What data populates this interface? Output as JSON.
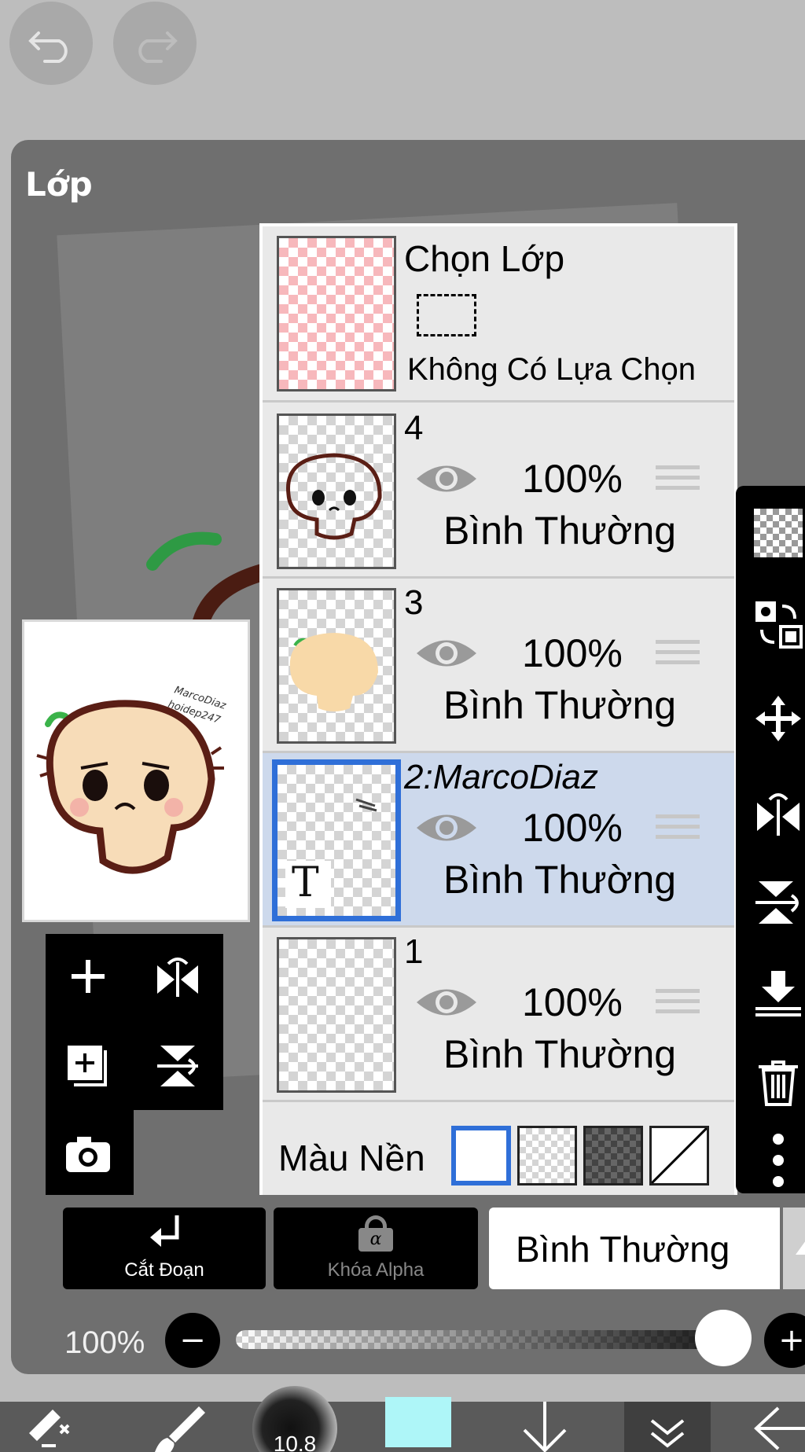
{
  "panel": {
    "title": "Lớp"
  },
  "preview": {
    "watermark_line1": "MarcoDiaz",
    "watermark_line2": "hoidep247"
  },
  "selection_row": {
    "title": "Chọn Lớp",
    "status": "Không Có Lựa Chọn"
  },
  "layers": [
    {
      "name": "4",
      "opacity": "100%",
      "blend": "Bình Thường",
      "selected": false
    },
    {
      "name": "3",
      "opacity": "100%",
      "blend": "Bình Thường",
      "selected": false
    },
    {
      "name": "2:MarcoDiaz",
      "opacity": "100%",
      "blend": "Bình Thường",
      "selected": true,
      "text_layer_mark": "T"
    },
    {
      "name": "1",
      "opacity": "100%",
      "blend": "Bình Thường",
      "selected": false
    }
  ],
  "background": {
    "label": "Màu Nền",
    "selected_swatch": "white"
  },
  "actions": {
    "clip_label": "Cắt Đoạn",
    "alpha_lock_label": "Khóa Alpha",
    "alpha_symbol": "α",
    "blend_mode": "Bình Thường"
  },
  "opacity_control": {
    "label": "100%",
    "minus": "−",
    "plus": "+",
    "value_fraction": 1.0
  },
  "brush": {
    "size_label": "10.8"
  },
  "colors": {
    "selected_blue": "#2f6fd8",
    "selected_row": "#cdd9ec",
    "panel_bg": "#6f6f6f",
    "current_color": "#aef6f8"
  }
}
